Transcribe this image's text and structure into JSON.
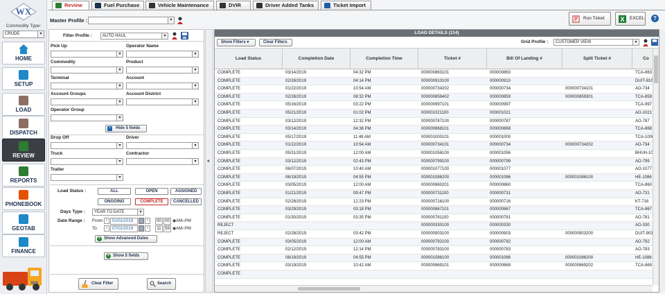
{
  "nav": {
    "logo": "WX",
    "commodity_label": "Commodity Type:",
    "commodity_value": "CRUDE",
    "items": [
      {
        "label": "HOME",
        "icon": "home-icon",
        "color": "#1e88c8"
      },
      {
        "label": "SETUP",
        "icon": "gear-icon",
        "color": "#1e88c8"
      },
      {
        "label": "LOAD",
        "icon": "load-icon",
        "color": "#8d6e63"
      },
      {
        "label": "DISPATCH",
        "icon": "dispatch-icon",
        "color": "#8d6e63"
      },
      {
        "label": "REVIEW",
        "icon": "review-icon",
        "color": "#2e7d32"
      },
      {
        "label": "REPORTS",
        "icon": "reports-icon",
        "color": "#2e7d32"
      },
      {
        "label": "PHONEBOOK",
        "icon": "phonebook-icon",
        "color": "#e65100"
      },
      {
        "label": "GEOTAB",
        "icon": "geotab-icon",
        "color": "#1e88c8"
      },
      {
        "label": "FINANCE",
        "icon": "finance-icon",
        "color": "#1e88c8"
      }
    ]
  },
  "tabs": [
    {
      "label": "Review",
      "active": true
    },
    {
      "label": "Fuel Purchase",
      "active": false
    },
    {
      "label": "Vehicle Maintenance",
      "active": false
    },
    {
      "label": "DVIR",
      "active": false
    },
    {
      "label": "Driver Added Tanks",
      "active": false
    },
    {
      "label": "Ticket Import",
      "active": false
    }
  ],
  "master_profile_label": "Master Profile :",
  "run_ticket_label": "Run Ticket",
  "excel_label": "EXCEL",
  "filter": {
    "profile_label": "Filter Profile :",
    "profile_value": "AUTO HAUL",
    "fields": [
      "Pick Up",
      "Operator Name",
      "Commodity",
      "Product",
      "Terminal",
      "Account",
      "Account Groups",
      "Account District",
      "Operator Group"
    ],
    "hide_button": "Hide 5 fields",
    "fields2": [
      "Drop Off",
      "Driver",
      "Truck",
      "Contractor",
      "Trailer"
    ],
    "load_status_label": "Load Status :",
    "status_buttons": [
      "ALL",
      "OPEN",
      "ASSIGNED",
      "ONGOING",
      "COMPLETE",
      "CANCELLED"
    ],
    "days_type_label": "Days Type :",
    "days_type_value": "YEAR TO DATE",
    "date_range_label": "Date Range :",
    "from_label": "From",
    "to_label": "To",
    "from_date": "01/01/2019",
    "to_date": "07/01/2019",
    "from_hour": "00",
    "from_min": "00",
    "to_hour": "11",
    "to_min": "59",
    "am": "AM",
    "pm": "PM",
    "advanced_dates": "Show Advanced Dates",
    "show_fields": "Show 5 fields",
    "clear_filter": "Clear Filter",
    "search": "Search"
  },
  "grid": {
    "title": "LOAD DETAILS (114)",
    "show_filters": "Show Filters",
    "clear_filters": "Clear Filters",
    "grid_profile_label": "Grid Profile :",
    "grid_profile_value": "CUSTOMER VIEW",
    "columns": [
      "Load Status",
      "Completion Date",
      "Completion Time",
      "Ticket #",
      "Bill Of Landing #",
      "Split Ticket #",
      "Co"
    ],
    "rows": [
      [
        "COMPLETE",
        "03/14/2019",
        "04:32 PM",
        "000000863101",
        "000000863",
        "",
        "TCA-863"
      ],
      [
        "COMPLETE",
        "02/28/2019",
        "04:14 PM",
        "000000910100",
        "000000910",
        "",
        "DUIT-910"
      ],
      [
        "COMPLETE",
        "01/22/2019",
        "10:54 AM",
        "000000734202",
        "000000734",
        "000000734101",
        "AO-734"
      ],
      [
        "COMPLETE",
        "02/28/2019",
        "08:32 PM",
        "000000859402",
        "000000859",
        "000000859301",
        "TCA-859"
      ],
      [
        "COMPLETE",
        "05/16/2019",
        "03:22 PM",
        "000000997101",
        "000000997",
        "",
        "TCA-997"
      ],
      [
        "COMPLETE",
        "05/21/2019",
        "01:02 PM",
        "000001021100",
        "000001021",
        "",
        "AO-1021"
      ],
      [
        "COMPLETE",
        "03/12/2019",
        "12:32 PM",
        "000000787100",
        "000000787",
        "",
        "AO-787"
      ],
      [
        "COMPLETE",
        "03/14/2019",
        "04:36 PM",
        "000000868101",
        "000000868",
        "",
        "TCA-868"
      ],
      [
        "COMPLETE",
        "05/17/2019",
        "11:48 AM",
        "000001000101",
        "000001000",
        "",
        "TCA-1000"
      ],
      [
        "COMPLETE",
        "01/22/2019",
        "10:54 AM",
        "000000734101",
        "000000734",
        "000000734202",
        "AO-734"
      ],
      [
        "COMPLETE",
        "05/31/2019",
        "12:00 AM",
        "000001056100",
        "000001056",
        "",
        "BHUH-105"
      ],
      [
        "COMPLETE",
        "03/12/2019",
        "02:43 PM",
        "000000799100",
        "000000799",
        "",
        "AO-799"
      ],
      [
        "COMPLETE",
        "06/07/2019",
        "10:40 AM",
        "000001077100",
        "000001077",
        "",
        "AO-1077"
      ],
      [
        "COMPLETE",
        "06/19/2019",
        "04:55 PM",
        "000001086200",
        "000001086",
        "000001086100",
        "HE-1086"
      ],
      [
        "COMPLETE",
        "03/05/2019",
        "12:00 AM",
        "000000860201",
        "000000860",
        "",
        "TCA-860"
      ],
      [
        "COMPLETE",
        "01/21/2019",
        "09:47 PM",
        "000000731100",
        "000000731",
        "",
        "AO-731"
      ],
      [
        "COMPLETE",
        "02/28/2019",
        "12:23 PM",
        "000000716100",
        "000000716",
        "",
        "KT-716"
      ],
      [
        "COMPLETE",
        "03/29/2019",
        "03:18 PM",
        "000000867101",
        "000000867",
        "",
        "TCA-867"
      ],
      [
        "COMPLETE",
        "01/30/2019",
        "03:35 PM",
        "000000781100",
        "000000781",
        "",
        "AO-781"
      ],
      [
        "REJECT",
        "",
        "",
        "000000330100",
        "000000330",
        "",
        "AO-330"
      ],
      [
        "REJECT",
        "02/28/2019",
        "03:42 PM",
        "000000903100",
        "000000903",
        "000000903200",
        "DUIT-903"
      ],
      [
        "COMPLETE",
        "03/05/2019",
        "12:00 AM",
        "000000792100",
        "000000792",
        "",
        "AO-792"
      ],
      [
        "COMPLETE",
        "02/12/2019",
        "12:14 PM",
        "000000783100",
        "000000783",
        "",
        "AO-783"
      ],
      [
        "COMPLETE",
        "06/19/2019",
        "04:55 PM",
        "000001086100",
        "000001086",
        "000001086200",
        "HE-1086"
      ],
      [
        "COMPLETE",
        "03/19/2019",
        "10:42 AM",
        "000000869101",
        "000000869",
        "000000869202",
        "TCA-869"
      ],
      [
        "COMPLETE",
        "",
        "",
        "",
        "",
        "",
        ""
      ]
    ]
  }
}
